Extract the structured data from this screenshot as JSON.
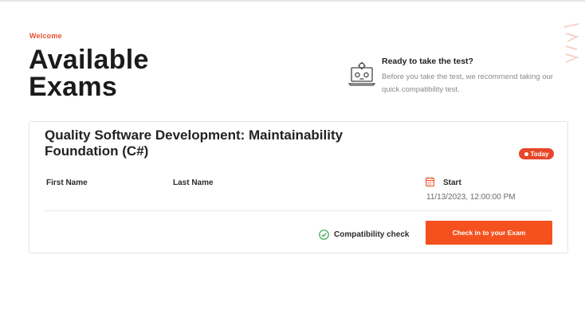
{
  "header": {
    "welcome": "Welcome",
    "title_line1": "Available",
    "title_line2": "Exams"
  },
  "promo": {
    "icon": "laptop-settings-icon",
    "title": "Ready to take the test?",
    "text": "Before you take the test, we recommend taking our quick compatibility test."
  },
  "exam": {
    "title": "Quality Software Development: Maintainability Foundation (C#)",
    "badge": "Today",
    "first_name_label": "First Name",
    "last_name_label": "Last Name",
    "start_label": "Start",
    "start_value": "11/13/2023, 12:00:00 PM",
    "compatibility_label": "Compatibility check",
    "checkin_label": "Check in to your Exam"
  },
  "colors": {
    "accent": "#f4511e",
    "badge": "#e8462a",
    "check": "#3aa856"
  }
}
